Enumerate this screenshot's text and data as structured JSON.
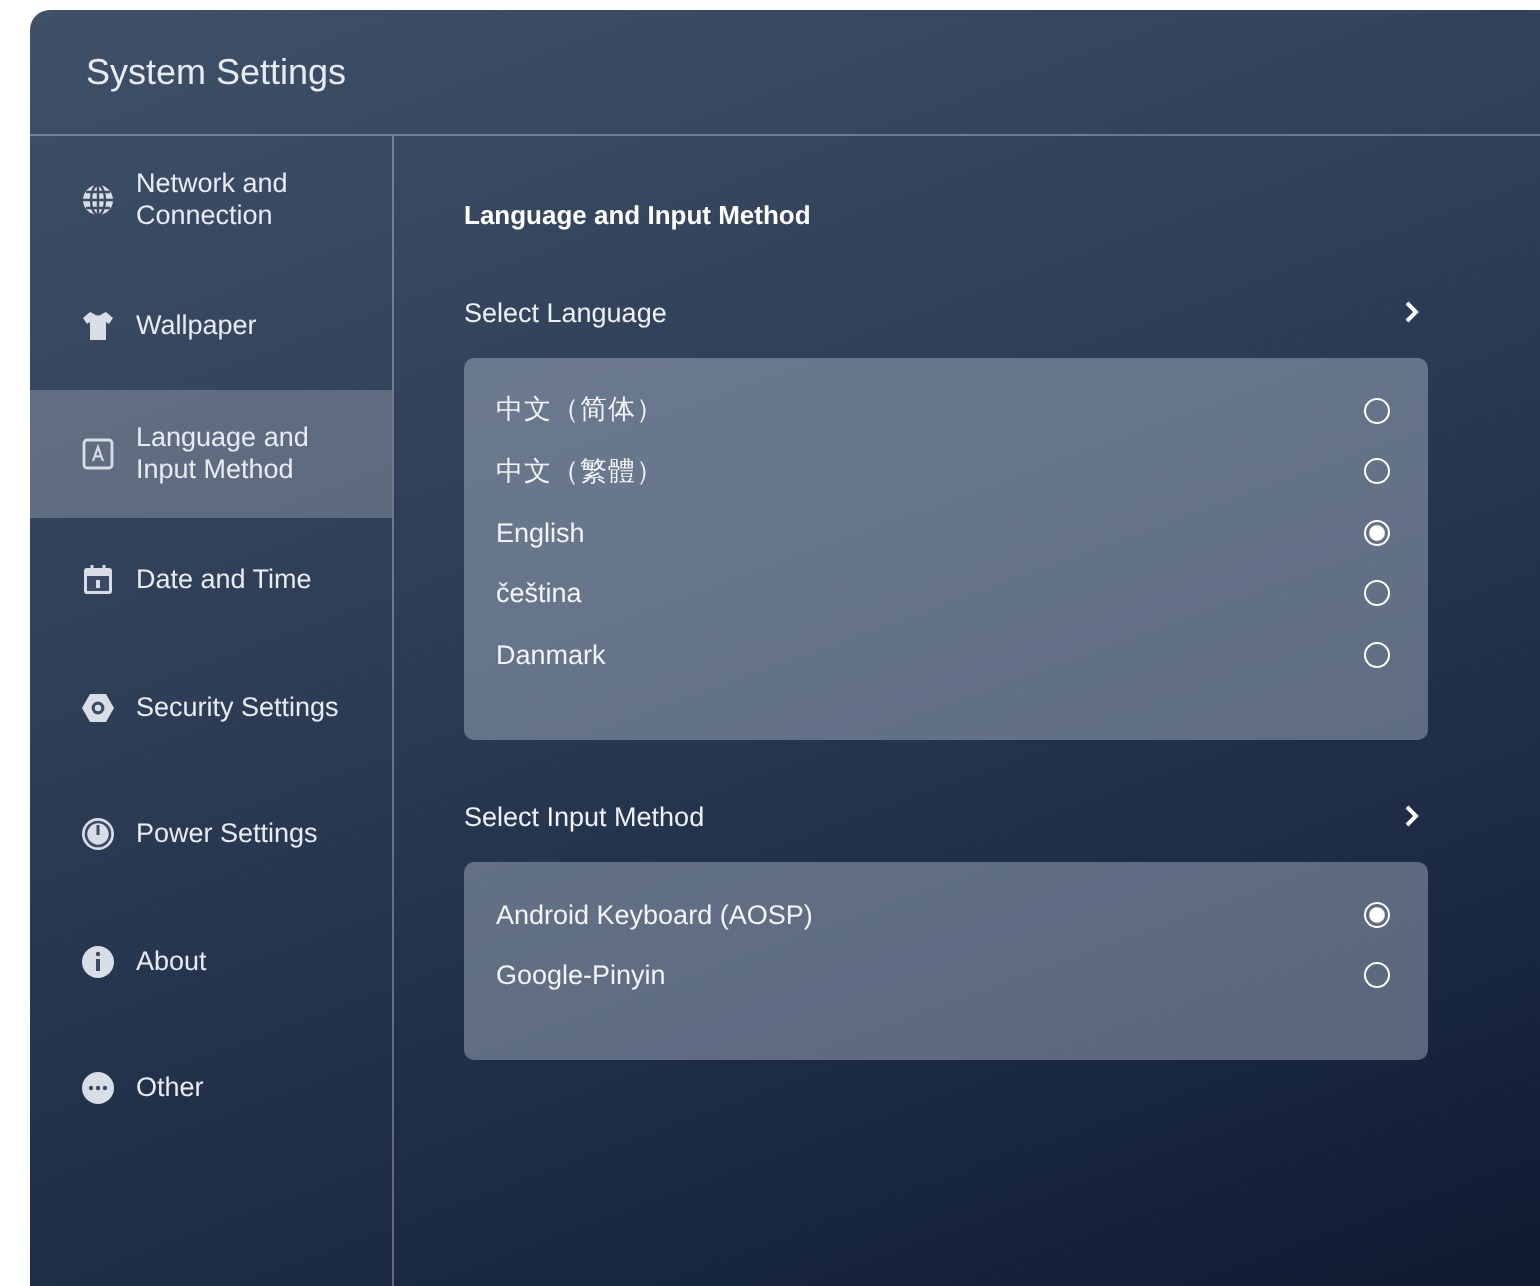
{
  "window": {
    "title": "System Settings"
  },
  "sidebar": {
    "items": [
      {
        "label": "Network and Connection",
        "selected": false
      },
      {
        "label": "Wallpaper",
        "selected": false
      },
      {
        "label": "Language and Input Method",
        "selected": true
      },
      {
        "label": "Date and Time",
        "selected": false
      },
      {
        "label": "Security Settings",
        "selected": false
      },
      {
        "label": "Power Settings",
        "selected": false
      },
      {
        "label": "About",
        "selected": false
      },
      {
        "label": "Other",
        "selected": false
      }
    ]
  },
  "content": {
    "heading": "Language and Input Method",
    "sections": [
      {
        "title": "Select Language",
        "options": [
          {
            "label": "中文（简体）",
            "selected": false
          },
          {
            "label": "中文（繁體）",
            "selected": false
          },
          {
            "label": "English",
            "selected": true
          },
          {
            "label": "čeština",
            "selected": false
          },
          {
            "label": "Danmark",
            "selected": false
          }
        ]
      },
      {
        "title": "Select Input Method",
        "options": [
          {
            "label": "Android Keyboard (AOSP)",
            "selected": true
          },
          {
            "label": "Google-Pinyin",
            "selected": false
          }
        ]
      }
    ]
  }
}
